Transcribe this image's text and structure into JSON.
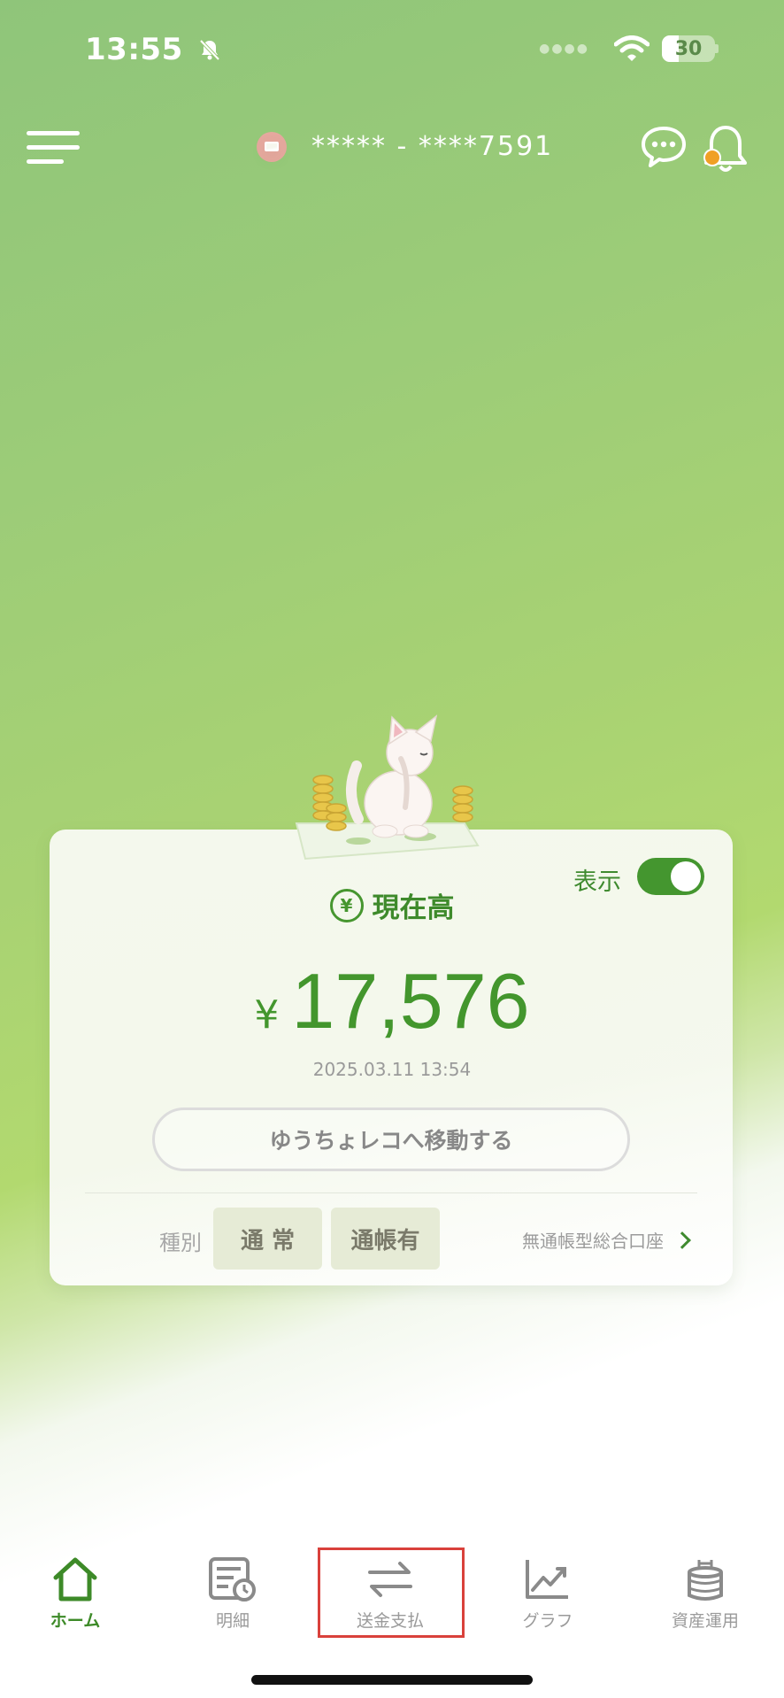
{
  "status_bar": {
    "time": "13:55",
    "battery": "30"
  },
  "header": {
    "account_number": "***** - ****7591"
  },
  "balance_card": {
    "toggle_label": "表示",
    "toggle_on": true,
    "title": "現在高",
    "currency_symbol": "¥",
    "amount": "17,576",
    "timestamp": "2025.03.11 13:54",
    "move_button": "ゆうちょレコへ移動する",
    "type_label": "種別",
    "badges": [
      "通 常",
      "通帳有"
    ],
    "account_type_link": "無通帳型総合口座"
  },
  "bottom_nav": [
    {
      "label": "ホーム",
      "icon": "home-icon",
      "active": true
    },
    {
      "label": "明細",
      "icon": "statement-icon",
      "active": false
    },
    {
      "label": "送金支払",
      "icon": "transfer-icon",
      "active": false
    },
    {
      "label": "グラフ",
      "icon": "graph-icon",
      "active": false
    },
    {
      "label": "資産運用",
      "icon": "asset-icon",
      "active": false
    }
  ],
  "colors": {
    "accent": "#44962f",
    "highlight": "#d9413b"
  }
}
